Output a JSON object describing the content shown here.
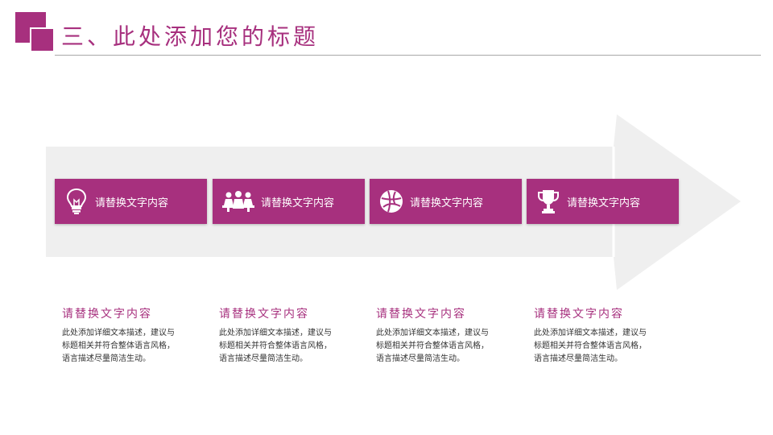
{
  "header": {
    "title": "三、此处添加您的标题"
  },
  "steps": [
    {
      "label": "请替换文字内容",
      "icon": "lightbulb-icon"
    },
    {
      "label": "请替换文字内容",
      "icon": "team-icon"
    },
    {
      "label": "请替换文字内容",
      "icon": "basketball-icon"
    },
    {
      "label": "请替换文字内容",
      "icon": "trophy-icon"
    }
  ],
  "descriptions": [
    {
      "title": "请替换文字内容",
      "text": "此处添加详细文本描述，建议与标题相关并符合整体语言风格，语言描述尽量简洁生动。"
    },
    {
      "title": "请替换文字内容",
      "text": "此处添加详细文本描述，建议与标题相关并符合整体语言风格，语言描述尽量简洁生动。"
    },
    {
      "title": "请替换文字内容",
      "text": "此处添加详细文本描述，建议与标题相关并符合整体语言风格，语言描述尽量简洁生动。"
    },
    {
      "title": "请替换文字内容",
      "text": "此处添加详细文本描述，建议与标题相关并符合整体语言风格，语言描述尽量简洁生动。"
    }
  ],
  "colors": {
    "accent": "#a7307e",
    "arrow": "#efefef",
    "text": "#333333"
  }
}
